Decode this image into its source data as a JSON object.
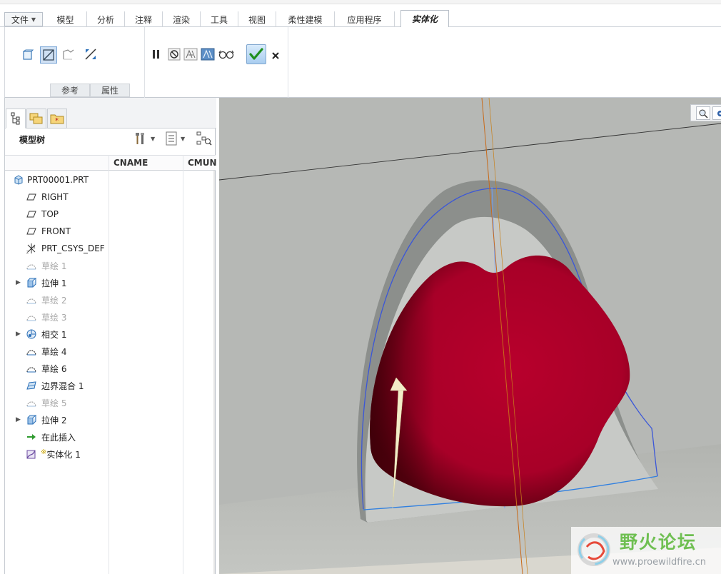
{
  "menubar": {
    "tabs": [
      {
        "label": "文件"
      },
      {
        "label": "模型"
      },
      {
        "label": "分析"
      },
      {
        "label": "注释"
      },
      {
        "label": "渲染"
      },
      {
        "label": "工具"
      },
      {
        "label": "视图"
      },
      {
        "label": "柔性建模"
      },
      {
        "label": "应用程序"
      },
      {
        "label": "实体化"
      }
    ],
    "active_tab": "实体化"
  },
  "ribbon": {
    "icons": [
      "solid-body-icon",
      "remove-material-icon",
      "replace-surface-icon",
      "flip-direction-icon",
      "pause-icon",
      "no-preview-icon",
      "preview-icon",
      "attached-preview-icon",
      "verify-icon",
      "confirm-icon",
      "cancel-icon"
    ],
    "group_tabs": [
      {
        "label": "参考"
      },
      {
        "label": "属性"
      }
    ]
  },
  "model_tree": {
    "title": "模型树",
    "columns": [
      {
        "label": "CNAME"
      },
      {
        "label": "CMUN"
      }
    ],
    "items": [
      {
        "label": "PRT00001.PRT",
        "icon": "part-icon",
        "dim": false,
        "expandable": false
      },
      {
        "label": "RIGHT",
        "icon": "datum-plane-icon",
        "dim": false,
        "expandable": false
      },
      {
        "label": "TOP",
        "icon": "datum-plane-icon",
        "dim": false,
        "expandable": false
      },
      {
        "label": "FRONT",
        "icon": "datum-plane-icon",
        "dim": false,
        "expandable": false
      },
      {
        "label": "PRT_CSYS_DEF",
        "icon": "csys-icon",
        "dim": false,
        "expandable": false
      },
      {
        "label": "草绘 1",
        "icon": "sketch-icon",
        "dim": true,
        "expandable": false
      },
      {
        "label": "拉伸 1",
        "icon": "extrude-icon",
        "dim": false,
        "expandable": true
      },
      {
        "label": "草绘 2",
        "icon": "sketch-icon",
        "dim": true,
        "expandable": false
      },
      {
        "label": "草绘 3",
        "icon": "sketch-icon",
        "dim": true,
        "expandable": false
      },
      {
        "label": "相交 1",
        "icon": "intersect-icon",
        "dim": false,
        "expandable": true
      },
      {
        "label": "草绘 4",
        "icon": "sketch-icon",
        "dim": false,
        "expandable": false
      },
      {
        "label": "草绘 6",
        "icon": "sketch-icon",
        "dim": false,
        "expandable": false
      },
      {
        "label": "边界混合 1",
        "icon": "boundary-blend-icon",
        "dim": false,
        "expandable": false
      },
      {
        "label": "草绘 5",
        "icon": "sketch-icon",
        "dim": true,
        "expandable": false
      },
      {
        "label": "拉伸 2",
        "icon": "extrude-icon",
        "dim": false,
        "expandable": true
      },
      {
        "label": "在此插入",
        "icon": "insert-here-icon",
        "dim": false,
        "expandable": false
      },
      {
        "label": "实体化 1",
        "icon": "solidify-icon",
        "dim": false,
        "expandable": false,
        "prefix": "※"
      }
    ]
  },
  "watermark": {
    "title": "野火论坛",
    "url": "www.proewildfire.cn"
  },
  "colors": {
    "surface_red": "#b0002a",
    "shell_gray": "#8f9290",
    "background_gray": "#b9bbb8",
    "accent_blue": "#7aa6d6",
    "ok_green": "#2a9a2a"
  }
}
